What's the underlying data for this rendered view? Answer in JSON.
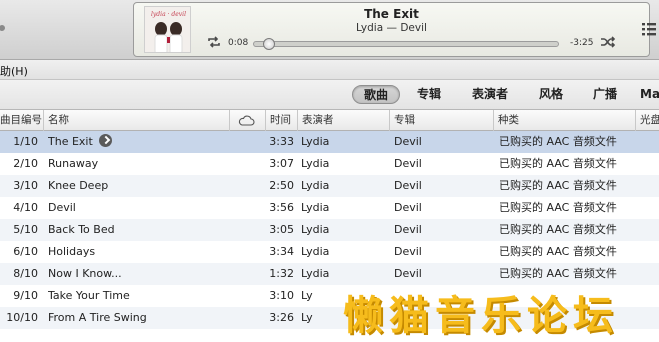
{
  "now_playing": {
    "title": "The Exit",
    "subtitle": "Lydia — Devil",
    "elapsed": "0:08",
    "remaining": "-3:25",
    "progress": 0.04,
    "album_art_text": "Lydia Devil"
  },
  "menu": {
    "help_label": "助(H)"
  },
  "tabs": [
    {
      "label": "歌曲",
      "selected": true
    },
    {
      "label": "专辑",
      "selected": false
    },
    {
      "label": "表演者",
      "selected": false
    },
    {
      "label": "风格",
      "selected": false
    },
    {
      "label": "广播",
      "selected": false
    },
    {
      "label": "Ma",
      "selected": false
    }
  ],
  "columns": {
    "track_number": "曲目编号",
    "name": "名称",
    "cloud": "cloud-icon",
    "time": "时间",
    "artist": "表演者",
    "album": "专辑",
    "kind": "种类",
    "extra": "光盘"
  },
  "tracks": [
    {
      "num": "1/10",
      "name": "The Exit",
      "time": "3:33",
      "artist": "Lydia",
      "album": "Devil",
      "kind": "已购买的 AAC 音频文件",
      "selected": true
    },
    {
      "num": "2/10",
      "name": "Runaway",
      "time": "3:07",
      "artist": "Lydia",
      "album": "Devil",
      "kind": "已购买的 AAC 音频文件"
    },
    {
      "num": "3/10",
      "name": "Knee Deep",
      "time": "2:50",
      "artist": "Lydia",
      "album": "Devil",
      "kind": "已购买的 AAC 音频文件"
    },
    {
      "num": "4/10",
      "name": "Devil",
      "time": "3:56",
      "artist": "Lydia",
      "album": "Devil",
      "kind": "已购买的 AAC 音频文件"
    },
    {
      "num": "5/10",
      "name": "Back To Bed",
      "time": "3:05",
      "artist": "Lydia",
      "album": "Devil",
      "kind": "已购买的 AAC 音频文件"
    },
    {
      "num": "6/10",
      "name": "Holidays",
      "time": "3:34",
      "artist": "Lydia",
      "album": "Devil",
      "kind": "已购买的 AAC 音频文件"
    },
    {
      "num": "8/10",
      "name": "Now I Know...",
      "time": "1:32",
      "artist": "Lydia",
      "album": "Devil",
      "kind": "已购买的 AAC 音频文件"
    },
    {
      "num": "9/10",
      "name": "Take Your Time",
      "time": "3:10",
      "artist": "Ly",
      "album": "",
      "kind": ""
    },
    {
      "num": "10/10",
      "name": "From A Tire Swing",
      "time": "3:26",
      "artist": "Ly",
      "album": "",
      "kind": ""
    }
  ],
  "watermark": "懒猫音乐论坛",
  "colors": {
    "selected_row": "#c8d6ea",
    "alt_row": "#f1f4f8",
    "watermark": "#f6bc1c"
  }
}
